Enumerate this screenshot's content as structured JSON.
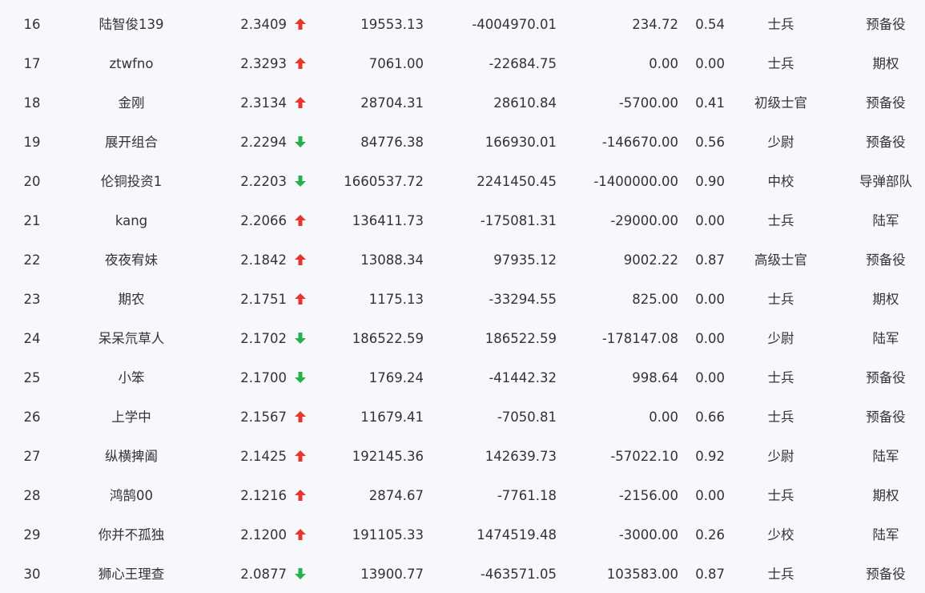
{
  "colors": {
    "background": "#f6f8fb",
    "text": "#333333",
    "up_arrow": "#e8342c",
    "down_arrow": "#27b14c"
  },
  "rows": [
    {
      "rank": "16",
      "name": "陆智俊139",
      "score": "2.3409",
      "trend": "up",
      "v1": "19553.13",
      "v2": "-4004970.01",
      "v3": "234.72",
      "ratio": "0.54",
      "level": "士兵",
      "team": "预备役"
    },
    {
      "rank": "17",
      "name": "ztwfno",
      "score": "2.3293",
      "trend": "up",
      "v1": "7061.00",
      "v2": "-22684.75",
      "v3": "0.00",
      "ratio": "0.00",
      "level": "士兵",
      "team": "期权"
    },
    {
      "rank": "18",
      "name": "金刚",
      "score": "2.3134",
      "trend": "up",
      "v1": "28704.31",
      "v2": "28610.84",
      "v3": "-5700.00",
      "ratio": "0.41",
      "level": "初级士官",
      "team": "预备役"
    },
    {
      "rank": "19",
      "name": "展开组合",
      "score": "2.2294",
      "trend": "down",
      "v1": "84776.38",
      "v2": "166930.01",
      "v3": "-146670.00",
      "ratio": "0.56",
      "level": "少尉",
      "team": "预备役"
    },
    {
      "rank": "20",
      "name": "伦铜投资1",
      "score": "2.2203",
      "trend": "down",
      "v1": "1660537.72",
      "v2": "2241450.45",
      "v3": "-1400000.00",
      "ratio": "0.90",
      "level": "中校",
      "team": "导弹部队"
    },
    {
      "rank": "21",
      "name": "kang",
      "score": "2.2066",
      "trend": "up",
      "v1": "136411.73",
      "v2": "-175081.31",
      "v3": "-29000.00",
      "ratio": "0.00",
      "level": "士兵",
      "team": "陆军"
    },
    {
      "rank": "22",
      "name": "夜夜宥妹",
      "score": "2.1842",
      "trend": "up",
      "v1": "13088.34",
      "v2": "97935.12",
      "v3": "9002.22",
      "ratio": "0.87",
      "level": "高级士官",
      "team": "预备役"
    },
    {
      "rank": "23",
      "name": "期农",
      "score": "2.1751",
      "trend": "up",
      "v1": "1175.13",
      "v2": "-33294.55",
      "v3": "825.00",
      "ratio": "0.00",
      "level": "士兵",
      "team": "期权"
    },
    {
      "rank": "24",
      "name": "呆呆氘草人",
      "score": "2.1702",
      "trend": "down",
      "v1": "186522.59",
      "v2": "186522.59",
      "v3": "-178147.08",
      "ratio": "0.00",
      "level": "少尉",
      "team": "陆军"
    },
    {
      "rank": "25",
      "name": "小笨",
      "score": "2.1700",
      "trend": "down",
      "v1": "1769.24",
      "v2": "-41442.32",
      "v3": "998.64",
      "ratio": "0.00",
      "level": "士兵",
      "team": "预备役"
    },
    {
      "rank": "26",
      "name": "上学中",
      "score": "2.1567",
      "trend": "up",
      "v1": "11679.41",
      "v2": "-7050.81",
      "v3": "0.00",
      "ratio": "0.66",
      "level": "士兵",
      "team": "预备役"
    },
    {
      "rank": "27",
      "name": "纵横捭阖",
      "score": "2.1425",
      "trend": "up",
      "v1": "192145.36",
      "v2": "142639.73",
      "v3": "-57022.10",
      "ratio": "0.92",
      "level": "少尉",
      "team": "陆军"
    },
    {
      "rank": "28",
      "name": "鸿鹄00",
      "score": "2.1216",
      "trend": "up",
      "v1": "2874.67",
      "v2": "-7761.18",
      "v3": "-2156.00",
      "ratio": "0.00",
      "level": "士兵",
      "team": "期权"
    },
    {
      "rank": "29",
      "name": "你并不孤独",
      "score": "2.1200",
      "trend": "up",
      "v1": "191105.33",
      "v2": "1474519.48",
      "v3": "-3000.00",
      "ratio": "0.26",
      "level": "少校",
      "team": "陆军"
    },
    {
      "rank": "30",
      "name": "狮心王理查",
      "score": "2.0877",
      "trend": "down",
      "v1": "13900.77",
      "v2": "-463571.05",
      "v3": "103583.00",
      "ratio": "0.87",
      "level": "士兵",
      "team": "预备役"
    }
  ]
}
